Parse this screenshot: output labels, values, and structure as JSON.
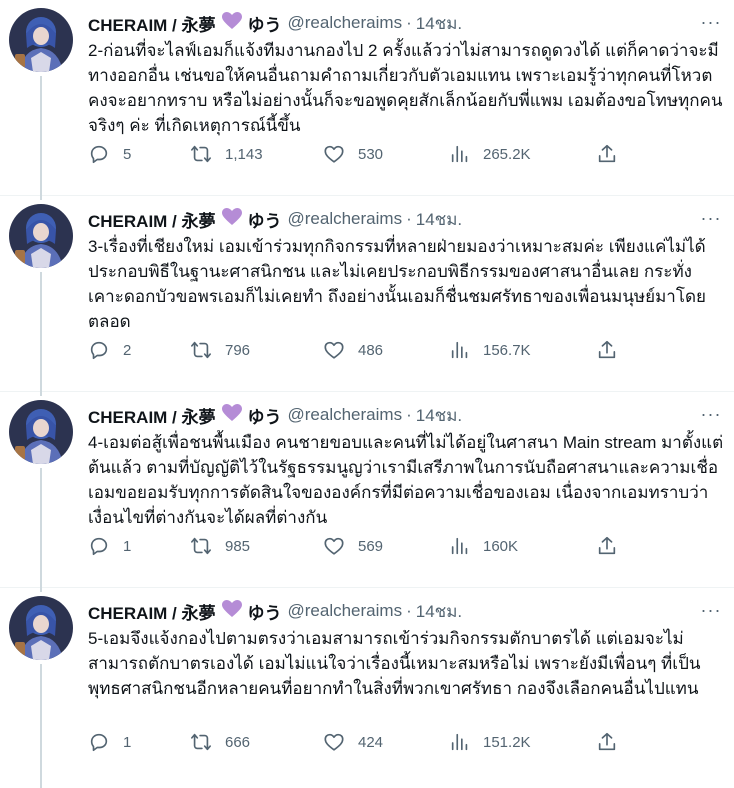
{
  "colors": {
    "text": "#0f1419",
    "muted": "#536471",
    "heart": "#b58cd6",
    "divider": "#eff3f4"
  },
  "tweets": [
    {
      "author_name": "CHERAIM / 永夢",
      "author_emoji": "💜",
      "author_name_suffix": "ゆう",
      "handle": "@realcheraims",
      "separator": "·",
      "time": "14ชม.",
      "more": "···",
      "text": "2-ก่อนที่จะไลฟ์เอมก็แจ้งทีมงานกองไป 2 ครั้งแล้วว่าไม่สามารถดูดวงได้ แต่ก็คาดว่าจะมีทางออกอื่น เช่นขอให้คนอื่นถามคำถามเกี่ยวกับตัวเอมแทน เพราะเอมรู้ว่าทุกคนที่โหวตคงจะอยากทราบ หรือไม่อย่างนั้นก็จะขอพูดคุยสักเล็กน้อยกับพี่แพม เอมต้องขอโทษทุกคนจริงๆ ค่ะ ที่เกิดเหตุการณ์นี้ขึ้น",
      "replies": "5",
      "retweets": "1,143",
      "likes": "530",
      "views": "265.2K"
    },
    {
      "author_name": "CHERAIM / 永夢",
      "author_emoji": "💜",
      "author_name_suffix": "ゆう",
      "handle": "@realcheraims",
      "separator": "·",
      "time": "14ชม.",
      "more": "···",
      "text": "3-เรื่องที่เชียงใหม่ เอมเข้าร่วมทุกกิจกรรมที่หลายฝ่ายมองว่าเหมาะสมค่ะ เพียงแค่ไม่ได้ประกอบพิธีในฐานะศาสนิกชน และไม่เคยประกอบพิธีกรรมของศาสนาอื่นเลย กระทั่งเคาะดอกบัวขอพรเอมก็ไม่เคยทำ ถึงอย่างนั้นเอมก็ชื่นชมศรัทธาของเพื่อนมนุษย์มาโดยตลอด",
      "replies": "2",
      "retweets": "796",
      "likes": "486",
      "views": "156.7K"
    },
    {
      "author_name": "CHERAIM / 永夢",
      "author_emoji": "💜",
      "author_name_suffix": "ゆう",
      "handle": "@realcheraims",
      "separator": "·",
      "time": "14ชม.",
      "more": "···",
      "text": "4-เอมต่อสู้เพื่อชนพื้นเมือง คนชายขอบและคนที่ไม่ได้อยู่ในศาสนา Main stream มาตั้งแต่ต้นแล้ว ตามที่บัญญัติไว้ในรัฐธรรมนูญว่าเรามีเสรีภาพในการนับถือศาสนาและความเชื่อ เอมขอยอมรับทุกการตัดสินใจขององค์กรที่มีต่อความเชื่อของเอม เนื่องจากเอมทราบว่าเงื่อนไขที่ต่างกันจะได้ผลที่ต่างกัน",
      "replies": "1",
      "retweets": "985",
      "likes": "569",
      "views": "160K"
    },
    {
      "author_name": "CHERAIM / 永夢",
      "author_emoji": "💜",
      "author_name_suffix": "ゆう",
      "handle": "@realcheraims",
      "separator": "·",
      "time": "14ชม.",
      "more": "···",
      "text": "5-เอมจึงแจ้งกองไปตามตรงว่าเอมสามารถเข้าร่วมกิจกรรมตักบาตรได้ แต่เอมจะไม่สามารถตักบาตรเองได้ เอมไม่แน่ใจว่าเรื่องนี้เหมาะสมหรือไม่ เพราะยังมีเพื่อนๆ ที่เป็นพุทธศาสนิกชนอีกหลายคนที่อยากทำในสิ่งที่พวกเขาศรัทธา กองจึงเลือกคนอื่นไปแทน",
      "replies": "1",
      "retweets": "666",
      "likes": "424",
      "views": "151.2K"
    }
  ],
  "icons": {
    "avatar": "avatar-image",
    "reply": "reply-icon",
    "retweet": "retweet-icon",
    "like": "like-icon",
    "views": "views-icon",
    "share": "share-icon",
    "more": "more-icon"
  }
}
